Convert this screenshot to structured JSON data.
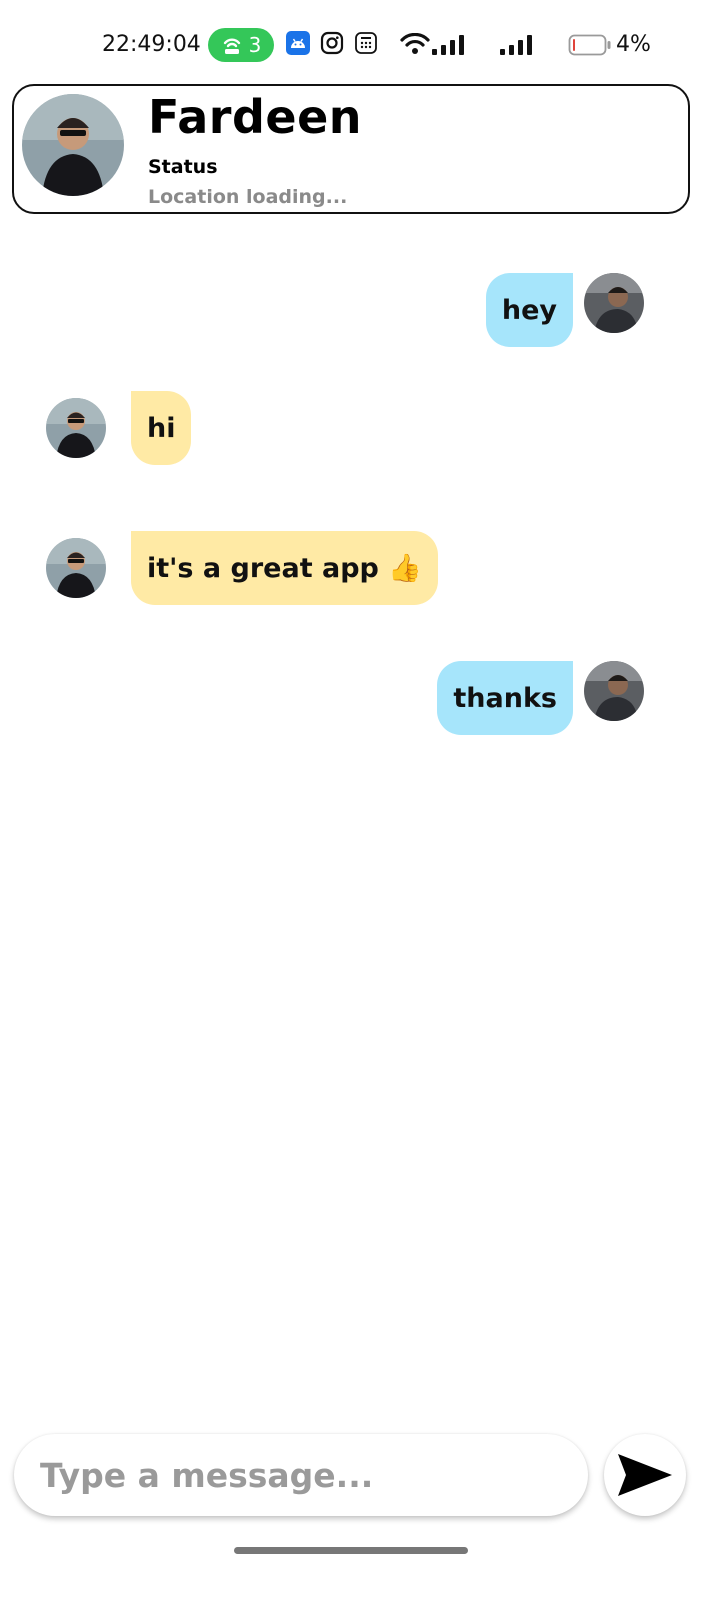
{
  "status_bar": {
    "time": "22:49:04",
    "hotspot_count": "3",
    "battery_percent": "4%",
    "icons": [
      "hotspot-icon",
      "android-icon",
      "instagram-icon",
      "calculator-icon",
      "wifi-icon",
      "signal-icon",
      "battery-icon"
    ]
  },
  "contact": {
    "name": "Fardeen",
    "status": "Status",
    "location": "Location loading..."
  },
  "messages": [
    {
      "direction": "outgoing",
      "text": "hey"
    },
    {
      "direction": "incoming",
      "text": "hi"
    },
    {
      "direction": "incoming",
      "text": "it's a great app 👍"
    },
    {
      "direction": "outgoing",
      "text": "thanks"
    }
  ],
  "composer": {
    "placeholder": "Type a message...",
    "value": ""
  },
  "colors": {
    "outgoing_bubble": "#a6e5fb",
    "incoming_bubble": "#ffeaa5",
    "hotspot_pill": "#34c759",
    "placeholder": "#9a9a9a"
  }
}
